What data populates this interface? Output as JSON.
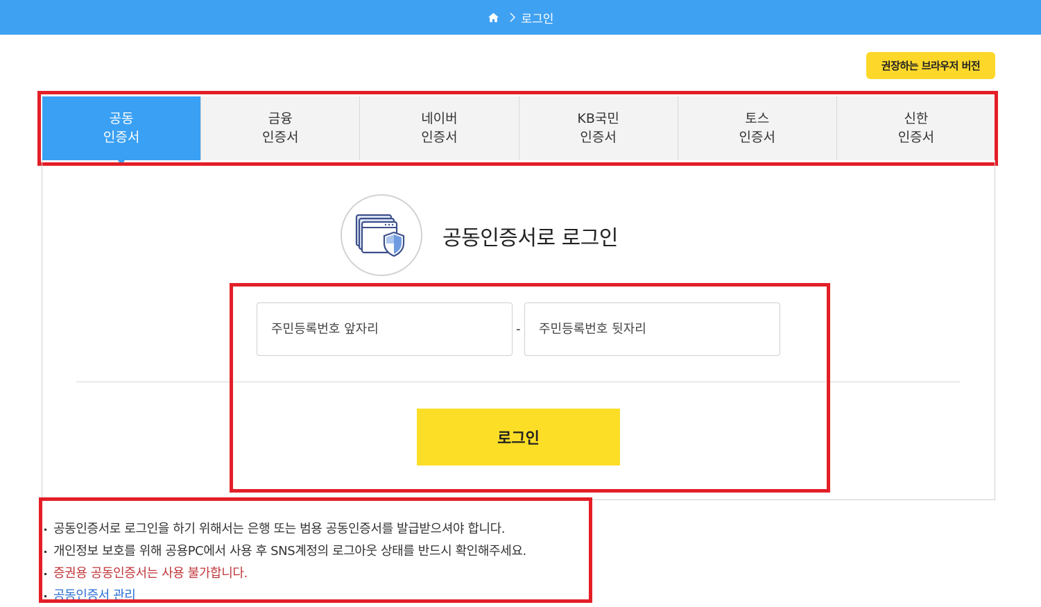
{
  "header": {
    "breadcrumb_current": "로그인",
    "home_icon": "home-icon",
    "separator_icon": "chevron-right-icon",
    "bg_color": "#3fa1f2"
  },
  "browser_button": {
    "label": "권장하는 브라우저 버전",
    "color": "#fdd82a"
  },
  "tabs": [
    {
      "line1": "공동",
      "line2": "인증서",
      "active": true
    },
    {
      "line1": "금융",
      "line2": "인증서",
      "active": false
    },
    {
      "line1": "네이버",
      "line2": "인증서",
      "active": false
    },
    {
      "line1": "KB국민",
      "line2": "인증서",
      "active": false
    },
    {
      "line1": "토스",
      "line2": "인증서",
      "active": false
    },
    {
      "line1": "신한",
      "line2": "인증서",
      "active": false
    }
  ],
  "main": {
    "cert_icon": "certificate-shield-icon",
    "title": "공동인증서로 로그인",
    "front_placeholder": "주민등록번호 앞자리",
    "separator": "-",
    "back_placeholder": "주민등록번호 뒷자리",
    "login_label": "로그인",
    "login_color": "#fdde27"
  },
  "notes": [
    {
      "text": "공동인증서로 로그인을 하기 위해서는 은행 또는 범용 공동인증서를 발급받으셔야 합니다.",
      "type": "normal"
    },
    {
      "text": "개인정보 보호를 위해 공용PC에서 사용 후 SNS계정의 로그아웃 상태를 반드시 확인해주세요.",
      "type": "normal"
    },
    {
      "text": "증권용 공동인증서는 사용 불가합니다.",
      "type": "warning"
    },
    {
      "text": "공동인증서 관리",
      "type": "link"
    }
  ],
  "highlight_color": "#e31e27"
}
